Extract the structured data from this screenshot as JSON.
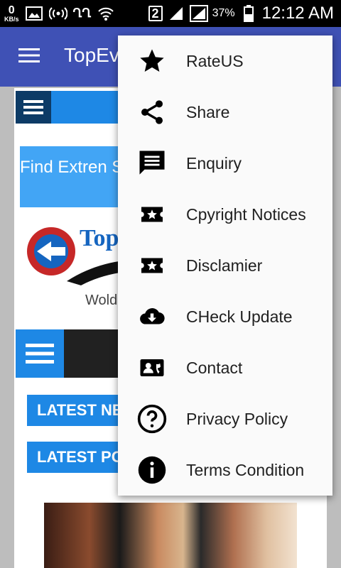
{
  "status_bar": {
    "speed_value": "0",
    "speed_unit": "KB/s",
    "regional_text": "ՂՂ",
    "sim_slot": "2",
    "battery": "37%",
    "time": "12:12 AM"
  },
  "app_bar": {
    "title": "TopEv"
  },
  "page": {
    "find_box_text": "Find Extren Sports",
    "wold_text": "Wold",
    "latest_news": "LATEST NEW",
    "latest_posts": "LATEST POST"
  },
  "menu": {
    "items": [
      {
        "label": "RateUS",
        "icon": "star-icon"
      },
      {
        "label": "Share",
        "icon": "share-icon"
      },
      {
        "label": "Enquiry",
        "icon": "message-icon"
      },
      {
        "label": "Cpyright Notices",
        "icon": "ticket-star-icon"
      },
      {
        "label": "Disclamier",
        "icon": "ticket-star-icon"
      },
      {
        "label": "CHeck Update",
        "icon": "cloud-download-icon"
      },
      {
        "label": "Contact",
        "icon": "contact-card-icon"
      },
      {
        "label": "Privacy Policy",
        "icon": "help-circle-icon"
      },
      {
        "label": "Terms Condition",
        "icon": "info-icon"
      }
    ]
  },
  "colors": {
    "app_bar": "#3f51b5",
    "accent_blue": "#1e88e5",
    "menu_bg": "#fafafa"
  }
}
